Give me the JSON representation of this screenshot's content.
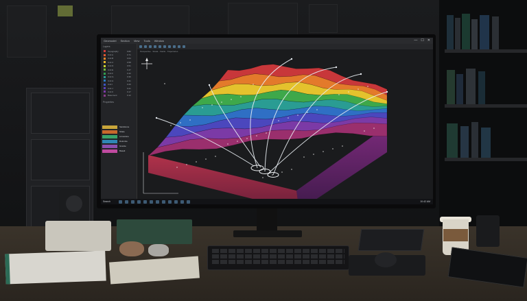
{
  "app": {
    "menu": [
      "Geomodel",
      "Section",
      "View",
      "Tools",
      "Window"
    ],
    "window_controls": [
      "—",
      "☐",
      "✕"
    ],
    "viewport_label": "Perspective · Strata · Faults · Trajectories"
  },
  "sidebar": {
    "layers_heading": "Layers",
    "layers": [
      {
        "name": "Topography",
        "value": "0.82",
        "color": "#d23c3c"
      },
      {
        "name": "Unit A",
        "value": "0.71",
        "color": "#e2572f"
      },
      {
        "name": "Unit B",
        "value": "0.64",
        "color": "#e8842a"
      },
      {
        "name": "Unit C",
        "value": "0.58",
        "color": "#e7b62a"
      },
      {
        "name": "Unit D",
        "value": "0.51",
        "color": "#c9d12e"
      },
      {
        "name": "Unit E",
        "value": "0.47",
        "color": "#6dbd3a"
      },
      {
        "name": "Unit F",
        "value": "0.42",
        "color": "#2f9e4e"
      },
      {
        "name": "Unit G",
        "value": "0.36",
        "color": "#2a9b94"
      },
      {
        "name": "Unit H",
        "value": "0.31",
        "color": "#2a7bc2"
      },
      {
        "name": "Unit I",
        "value": "0.26",
        "color": "#3b55c2"
      },
      {
        "name": "Unit J",
        "value": "0.21",
        "color": "#5a3fb5"
      },
      {
        "name": "Unit K",
        "value": "0.17",
        "color": "#7a3aa8"
      },
      {
        "name": "Basement",
        "value": "0.12",
        "color": "#8a3a8a"
      }
    ],
    "properties_heading": "Properties",
    "strata_swatches": [
      {
        "label": "Sandstone",
        "color": "#c9a63a"
      },
      {
        "label": "Shale",
        "color": "#c8682c"
      },
      {
        "label": "Limestone",
        "color": "#3aa36a"
      },
      {
        "label": "Dolomite",
        "color": "#2f86b5"
      },
      {
        "label": "Granite",
        "color": "#8a4fae"
      },
      {
        "label": "Basalt",
        "color": "#c04aa0"
      }
    ]
  },
  "taskbar": {
    "start_label": "Search",
    "apps": 12,
    "time": "10:42 AM"
  },
  "palette": {
    "top": "#c8373a",
    "upper_orange": "#e37a2b",
    "yellow": "#e4c22d",
    "green": "#3ea84a",
    "teal": "#2a9c93",
    "blue": "#2f6fc4",
    "indigo": "#4b47bd",
    "purple": "#7b3aa6",
    "magenta_base": "#9a2f6d",
    "trajectory": "#e9eef3"
  }
}
